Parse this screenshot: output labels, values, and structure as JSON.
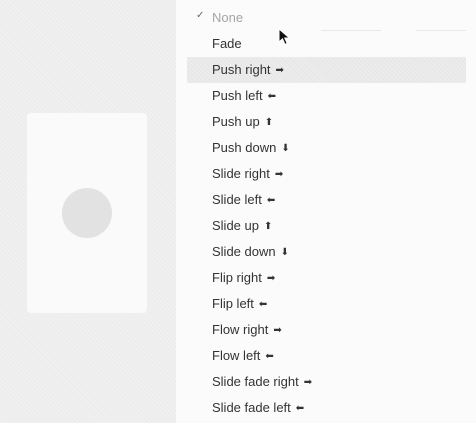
{
  "menu": {
    "items": [
      {
        "label": "None",
        "arrow": "",
        "checked": true,
        "disabled": true,
        "hover": false
      },
      {
        "label": "Fade",
        "arrow": "",
        "checked": false,
        "disabled": false,
        "hover": false
      },
      {
        "label": "Push right",
        "arrow": "➡",
        "checked": false,
        "disabled": false,
        "hover": true
      },
      {
        "label": "Push left",
        "arrow": "⬅",
        "checked": false,
        "disabled": false,
        "hover": false
      },
      {
        "label": "Push up",
        "arrow": "⬆",
        "checked": false,
        "disabled": false,
        "hover": false
      },
      {
        "label": "Push down",
        "arrow": "⬇",
        "checked": false,
        "disabled": false,
        "hover": false
      },
      {
        "label": "Slide right",
        "arrow": "➡",
        "checked": false,
        "disabled": false,
        "hover": false
      },
      {
        "label": "Slide left",
        "arrow": "⬅",
        "checked": false,
        "disabled": false,
        "hover": false
      },
      {
        "label": "Slide up",
        "arrow": "⬆",
        "checked": false,
        "disabled": false,
        "hover": false
      },
      {
        "label": "Slide down",
        "arrow": "⬇",
        "checked": false,
        "disabled": false,
        "hover": false
      },
      {
        "label": "Flip right",
        "arrow": "➡",
        "checked": false,
        "disabled": false,
        "hover": false
      },
      {
        "label": "Flip left",
        "arrow": "⬅",
        "checked": false,
        "disabled": false,
        "hover": false
      },
      {
        "label": "Flow right",
        "arrow": "➡",
        "checked": false,
        "disabled": false,
        "hover": false
      },
      {
        "label": "Flow left",
        "arrow": "⬅",
        "checked": false,
        "disabled": false,
        "hover": false
      },
      {
        "label": "Slide fade right",
        "arrow": "➡",
        "checked": false,
        "disabled": false,
        "hover": false
      },
      {
        "label": "Slide fade left",
        "arrow": "⬅",
        "checked": false,
        "disabled": false,
        "hover": false
      }
    ],
    "check_glyph": "✓"
  },
  "colors": {
    "hover_bg": "#ececec",
    "disabled_text": "#a5a5a5",
    "text": "#333333"
  }
}
